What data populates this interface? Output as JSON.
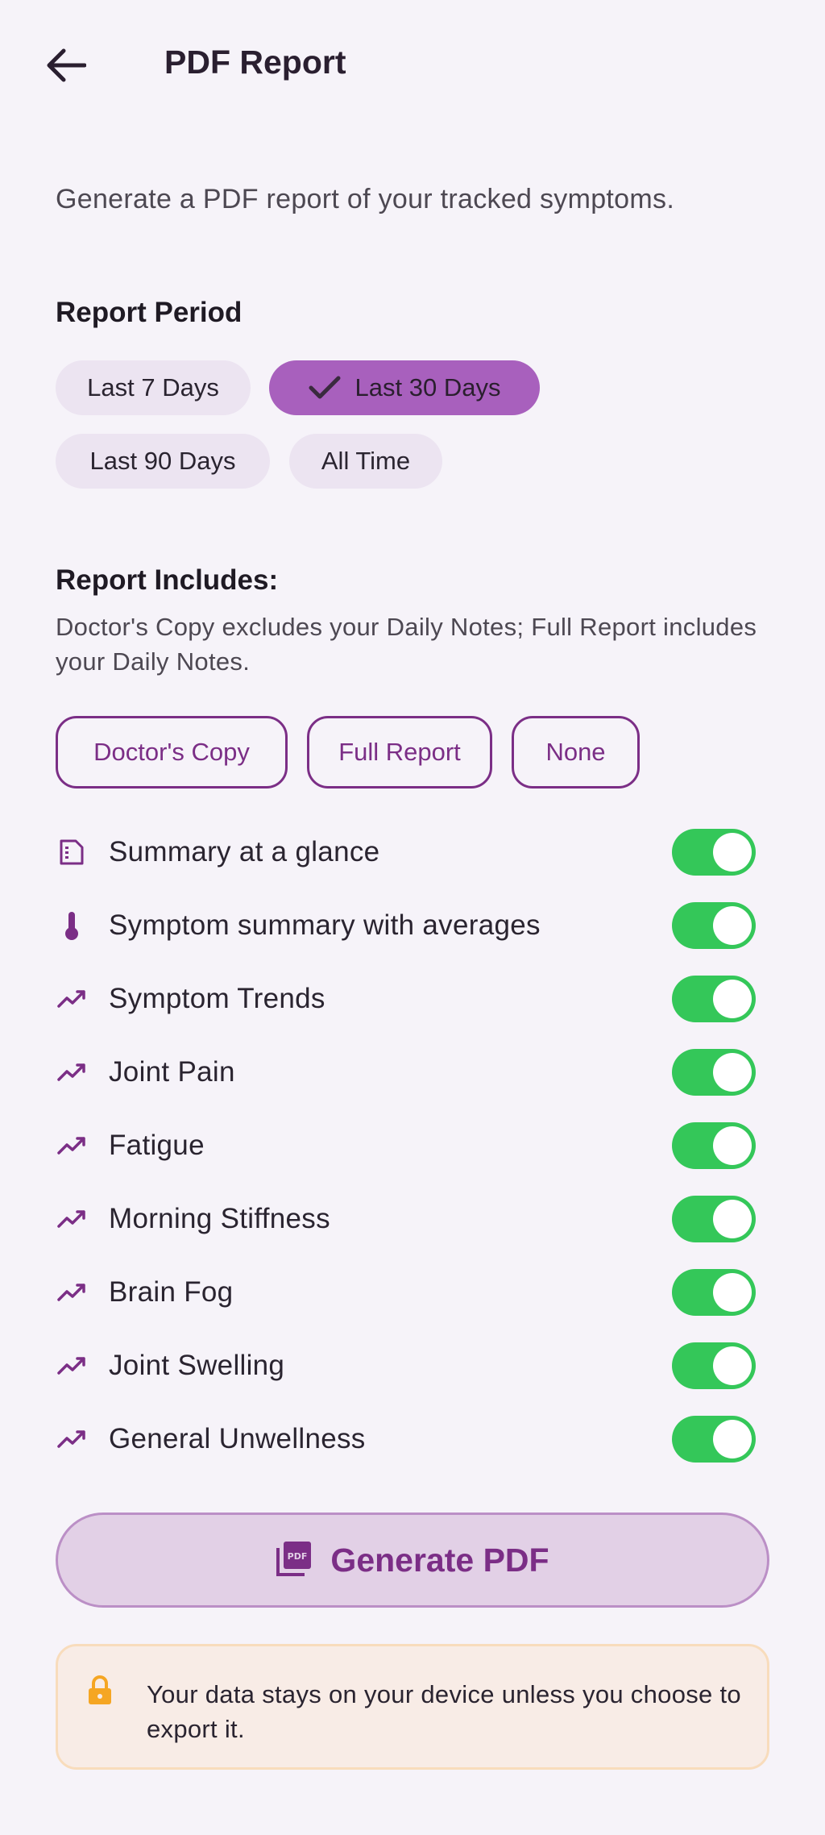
{
  "header": {
    "title": "PDF Report",
    "back_icon": "arrow-left-icon"
  },
  "intro": "Generate a PDF report of your tracked symptoms.",
  "period": {
    "title": "Report Period",
    "chips": [
      "Last 7 Days",
      "Last 30 Days",
      "Last 90 Days",
      "All Time"
    ],
    "selected": "Last 30 Days"
  },
  "includes": {
    "title": "Report Includes:",
    "description": "Doctor's Copy excludes your Daily Notes; Full Report includes your Daily Notes.",
    "presets": [
      "Doctor's Copy",
      "Full Report",
      "None"
    ],
    "options": [
      {
        "label": "Summary at a glance",
        "icon": "summary-document-icon",
        "on": true
      },
      {
        "label": "Symptom summary with averages",
        "icon": "thermometer-icon",
        "on": true
      },
      {
        "label": "Symptom Trends",
        "icon": "trend-icon",
        "on": true
      },
      {
        "label": "Joint Pain",
        "icon": "trend-icon",
        "on": true
      },
      {
        "label": "Fatigue",
        "icon": "trend-icon",
        "on": true
      },
      {
        "label": "Morning Stiffness",
        "icon": "trend-icon",
        "on": true
      },
      {
        "label": "Brain Fog",
        "icon": "trend-icon",
        "on": true
      },
      {
        "label": "Joint Swelling",
        "icon": "trend-icon",
        "on": true
      },
      {
        "label": "General Unwellness",
        "icon": "trend-icon",
        "on": true
      }
    ]
  },
  "generate": {
    "label": "Generate PDF",
    "icon": "pdf-file-icon"
  },
  "notice": {
    "text": "Your data stays on your device unless you choose to export it.",
    "icon": "lock-icon"
  },
  "colors": {
    "accent": "#7b2e86",
    "chip_selected": "#a860bd",
    "toggle_on": "#34c759",
    "notice_bg": "#f8ece6",
    "lock": "#f5a623"
  }
}
